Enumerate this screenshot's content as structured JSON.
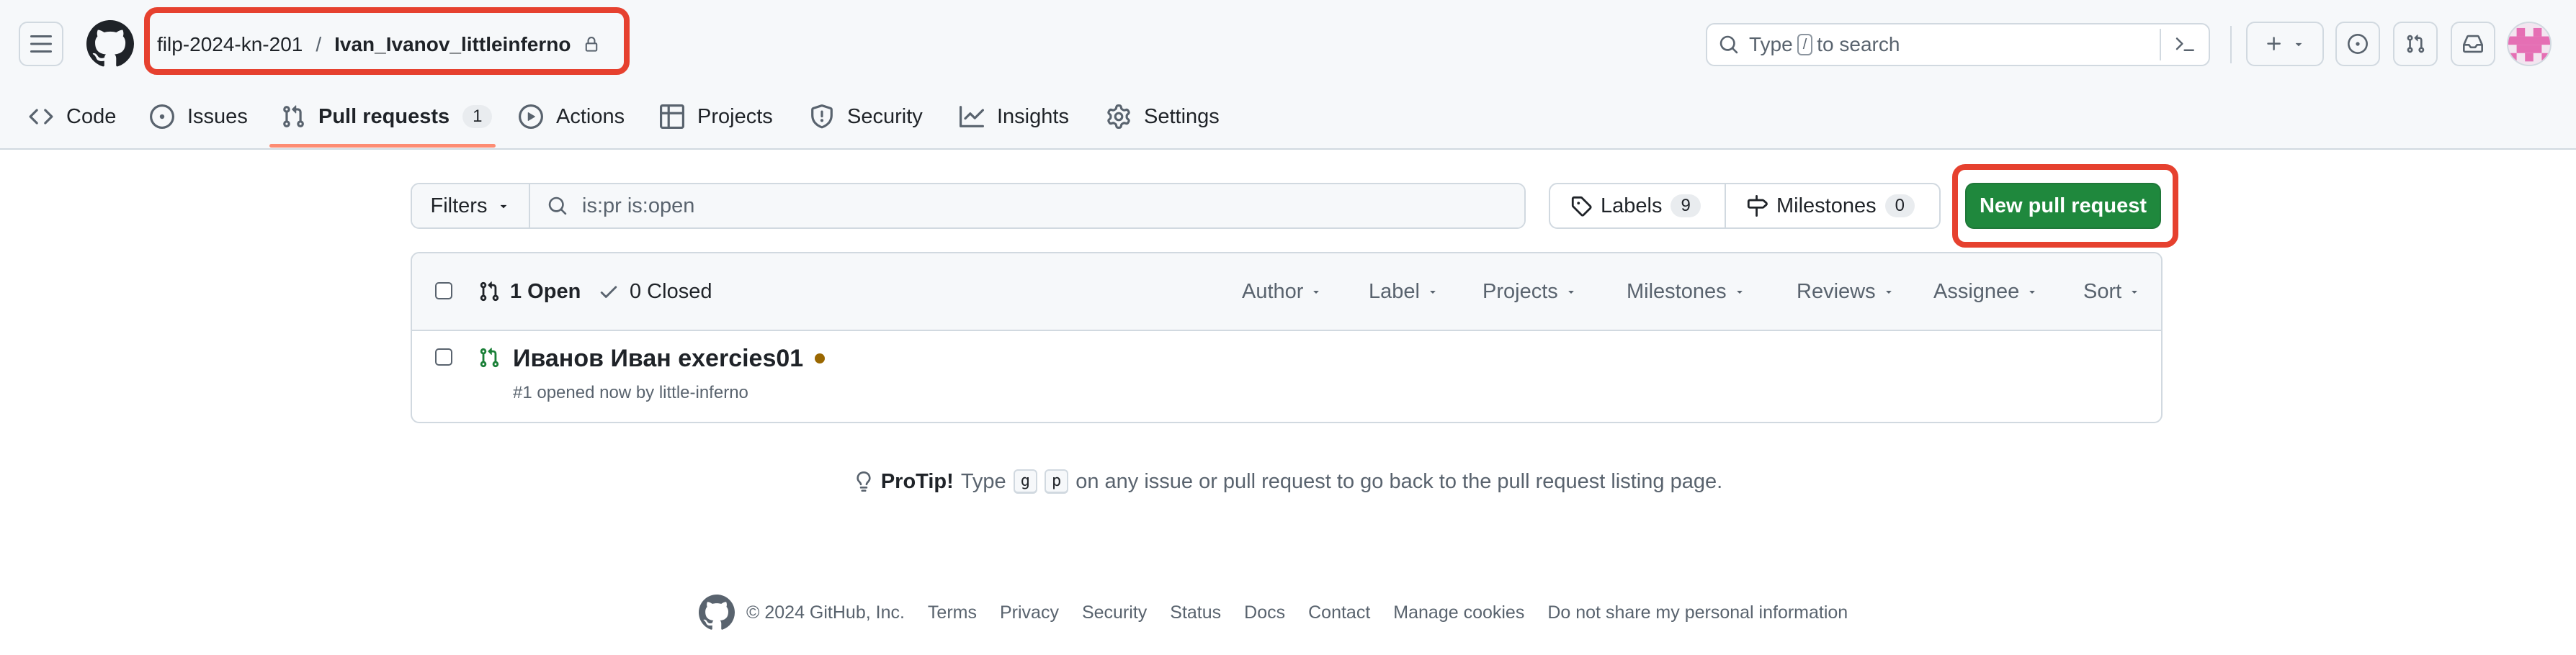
{
  "header": {
    "org": "filp-2024-kn-201",
    "separator": "/",
    "repo": "Ivan_Ivanov_littleinferno",
    "search_prefix": "Type",
    "search_key": "/",
    "search_suffix": "to search"
  },
  "tabs": [
    {
      "label": "Code",
      "icon": "code-icon"
    },
    {
      "label": "Issues",
      "icon": "issue-icon"
    },
    {
      "label": "Pull requests",
      "icon": "git-pull-request-icon",
      "count": "1",
      "selected": true
    },
    {
      "label": "Actions",
      "icon": "play-icon"
    },
    {
      "label": "Projects",
      "icon": "table-icon"
    },
    {
      "label": "Security",
      "icon": "shield-icon"
    },
    {
      "label": "Insights",
      "icon": "graph-icon"
    },
    {
      "label": "Settings",
      "icon": "gear-icon"
    }
  ],
  "toolbar": {
    "filters_label": "Filters",
    "filter_query": "is:pr is:open",
    "labels_label": "Labels",
    "labels_count": "9",
    "milestones_label": "Milestones",
    "milestones_count": "0",
    "new_pr_label": "New pull request"
  },
  "list": {
    "open_label": "1 Open",
    "closed_label": "0 Closed",
    "filters": [
      "Author",
      "Label",
      "Projects",
      "Milestones",
      "Reviews",
      "Assignee",
      "Sort"
    ],
    "items": [
      {
        "title": "Иванов Иван exercies01",
        "meta": "#1 opened now by little-inferno"
      }
    ]
  },
  "protip": {
    "lead": "ProTip!",
    "pre": "Type",
    "key1": "g",
    "key2": "p",
    "post": "on any issue or pull request to go back to the pull request listing page."
  },
  "footer": {
    "copyright": "© 2024 GitHub, Inc.",
    "links": [
      "Terms",
      "Privacy",
      "Security",
      "Status",
      "Docs",
      "Contact",
      "Manage cookies",
      "Do not share my personal information"
    ]
  },
  "colors": {
    "accent_green": "#1f883d",
    "annotation_red": "#e6412f",
    "tab_underline": "#fd8c73",
    "draft_dot": "#9a6700"
  }
}
